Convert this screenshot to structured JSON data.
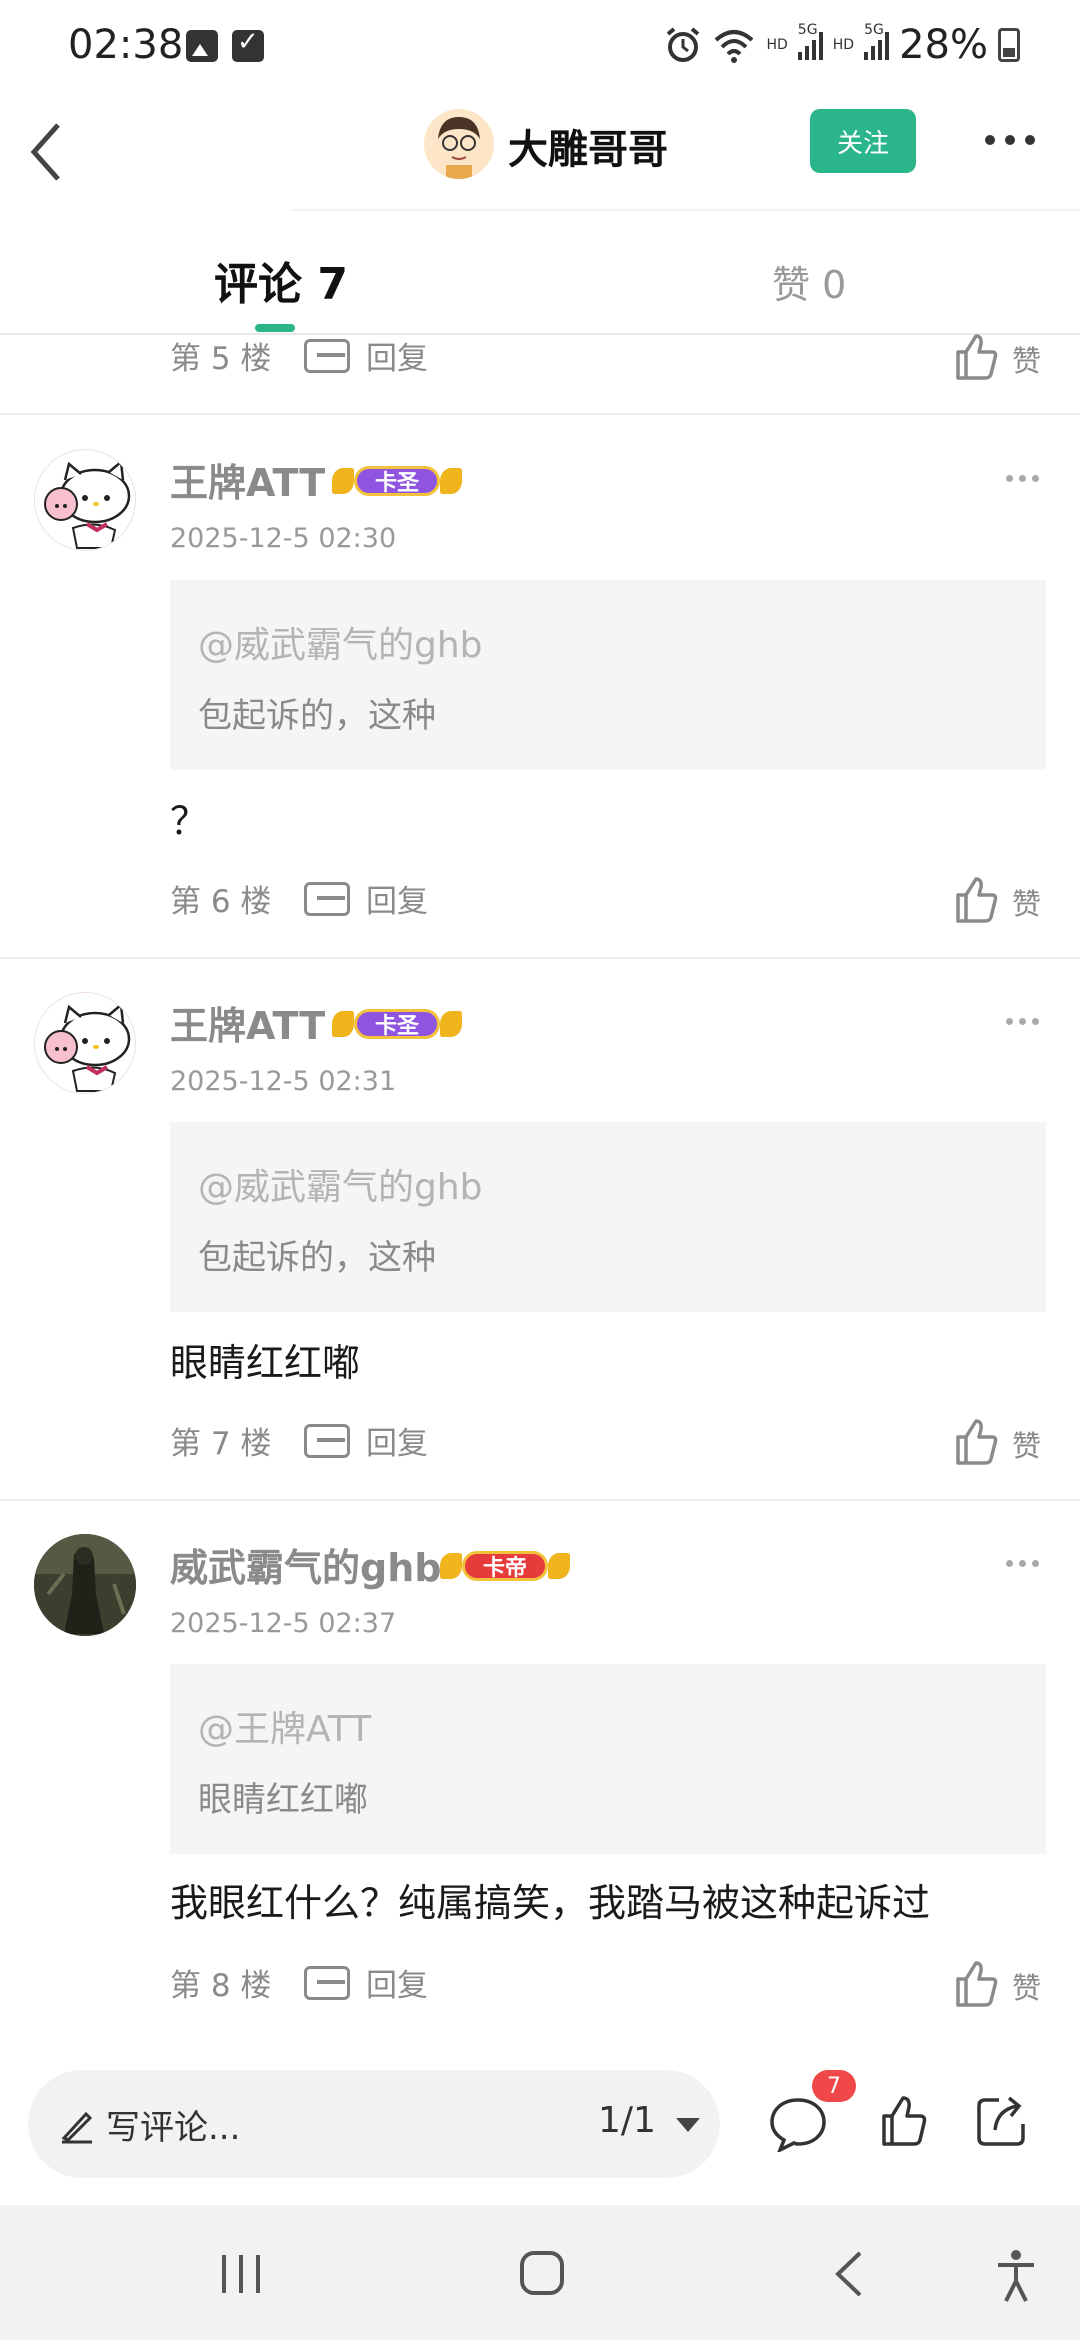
{
  "status_bar": {
    "time": "02:38",
    "network_1": "HD",
    "signal_1": "5G",
    "network_2": "HD",
    "signal_2": "5G",
    "battery": "28%"
  },
  "header": {
    "username": "大雕哥哥",
    "follow_label": "关注"
  },
  "tabs": {
    "comments_label": "评论 7",
    "likes_label": "赞 0"
  },
  "partial_row": {
    "floor": "第 5 楼",
    "reply": "回复",
    "like": "赞"
  },
  "comments": [
    {
      "author": "王牌ATT",
      "badge": "卡圣",
      "date": "2025-12-5 02:30",
      "quote_user": "@威武霸气的ghb",
      "quote_text": "包起诉的，这种",
      "body": "？",
      "floor": "第 6 楼",
      "reply": "回复",
      "like": "赞"
    },
    {
      "author": "王牌ATT",
      "badge": "卡圣",
      "date": "2025-12-5 02:31",
      "quote_user": "@威武霸气的ghb",
      "quote_text": "包起诉的，这种",
      "body": "眼睛红红嘟",
      "floor": "第 7 楼",
      "reply": "回复",
      "like": "赞"
    },
    {
      "author": "威武霸气的ghb",
      "badge": "卡帝",
      "date": "2025-12-5 02:37",
      "quote_user": "@王牌ATT",
      "quote_text": "眼睛红红嘟",
      "body": "我眼红什么？纯属搞笑，我踏马被这种起诉过",
      "floor": "第 8 楼",
      "reply": "回复",
      "like": "赞"
    }
  ],
  "bottom_bar": {
    "write_placeholder": "写评论...",
    "page_indicator": "1/1",
    "comment_count": "7"
  },
  "colors": {
    "accent": "#2bb58a",
    "badge_red": "#f04848"
  }
}
